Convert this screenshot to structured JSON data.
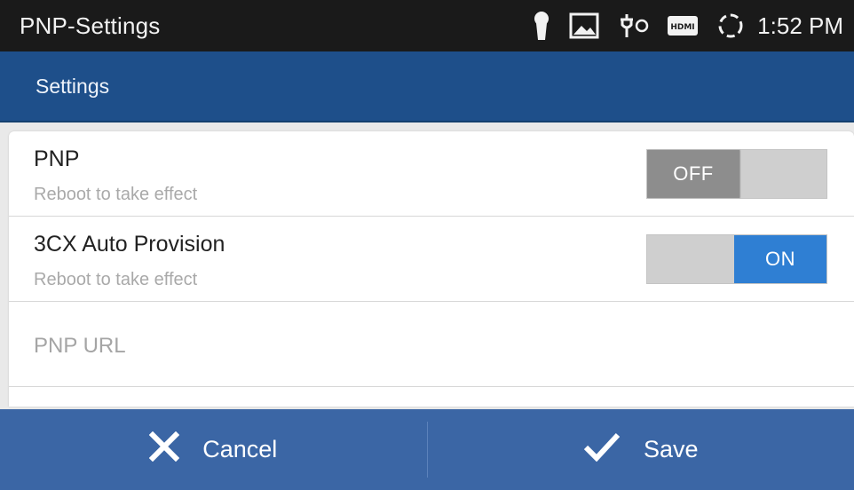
{
  "status_bar": {
    "app_title": "PNP-Settings",
    "time": "1:52 PM",
    "icons": [
      "keyhole-icon",
      "image-icon",
      "usb-debug-icon",
      "hdmi-icon",
      "sync-icon"
    ],
    "hdmi_text": "HDMI"
  },
  "header": {
    "title": "Settings"
  },
  "settings": {
    "pnp": {
      "label": "PNP",
      "hint": "Reboot to take effect",
      "state": "OFF"
    },
    "auto_provision": {
      "label": "3CX Auto Provision",
      "hint": "Reboot to take effect",
      "state": "ON"
    },
    "pnp_url": {
      "placeholder": "PNP URL"
    }
  },
  "footer": {
    "cancel_label": "Cancel",
    "save_label": "Save"
  },
  "colors": {
    "header": "#1e4f8a",
    "footer": "#3b66a5",
    "toggle_on": "#2f7fd3",
    "toggle_off": "#8d8d8d"
  }
}
